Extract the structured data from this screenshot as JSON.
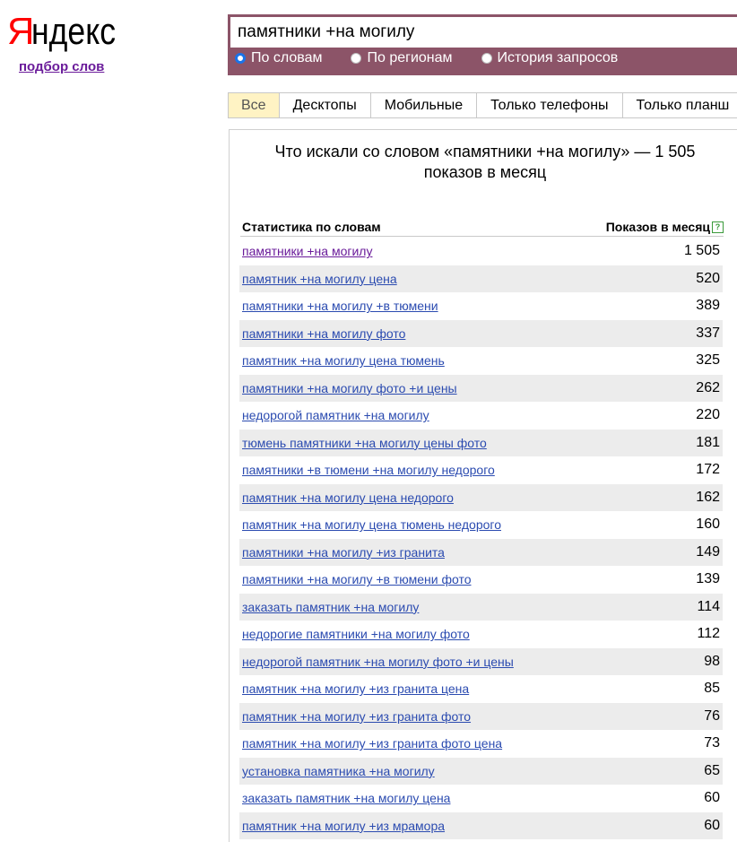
{
  "logo": {
    "text": "Яндекс"
  },
  "subtitle": "подбор слов",
  "search": {
    "value": "памятники +на могилу"
  },
  "radios": [
    {
      "label": "По словам",
      "checked": true
    },
    {
      "label": "По регионам",
      "checked": false
    },
    {
      "label": "История запросов",
      "checked": false
    }
  ],
  "tabs": [
    {
      "label": "Все",
      "active": true
    },
    {
      "label": "Десктопы",
      "active": false
    },
    {
      "label": "Мобильные",
      "active": false
    },
    {
      "label": "Только телефоны",
      "active": false
    },
    {
      "label": "Только планш",
      "active": false
    }
  ],
  "panel": {
    "heading": "Что искали со словом «памятники +на могилу» — 1 505 показов в месяц",
    "col_left": "Статистика по словам",
    "col_right": "Показов в месяц",
    "help_icon": "?"
  },
  "rows": [
    {
      "phrase": "памятники +на могилу",
      "count": "1 505"
    },
    {
      "phrase": "памятник +на могилу цена",
      "count": "520"
    },
    {
      "phrase": "памятники +на могилу +в тюмени",
      "count": "389"
    },
    {
      "phrase": "памятники +на могилу фото",
      "count": "337"
    },
    {
      "phrase": "памятник +на могилу цена тюмень",
      "count": "325"
    },
    {
      "phrase": "памятники +на могилу фото +и цены",
      "count": "262"
    },
    {
      "phrase": "недорогой памятник +на могилу",
      "count": "220"
    },
    {
      "phrase": "тюмень памятники +на могилу цены фото",
      "count": "181"
    },
    {
      "phrase": "памятники +в тюмени +на могилу недорого",
      "count": "172"
    },
    {
      "phrase": "памятник +на могилу цена недорого",
      "count": "162"
    },
    {
      "phrase": "памятник +на могилу цена тюмень недорого",
      "count": "160"
    },
    {
      "phrase": "памятники +на могилу +из гранита",
      "count": "149"
    },
    {
      "phrase": "памятники +на могилу +в тюмени фото",
      "count": "139"
    },
    {
      "phrase": "заказать памятник +на могилу",
      "count": "114"
    },
    {
      "phrase": "недорогие памятники +на могилу фото",
      "count": "112"
    },
    {
      "phrase": "недорогой памятник +на могилу фото +и цены",
      "count": "98"
    },
    {
      "phrase": "памятник +на могилу +из гранита цена",
      "count": "85"
    },
    {
      "phrase": "памятник +на могилу +из гранита фото",
      "count": "76"
    },
    {
      "phrase": "памятник +на могилу +из гранита фото цена",
      "count": "73"
    },
    {
      "phrase": "установка памятника +на могилу",
      "count": "65"
    },
    {
      "phrase": "заказать памятник +на могилу цена",
      "count": "60"
    },
    {
      "phrase": "памятник +на могилу +из мрамора",
      "count": "60"
    }
  ],
  "colors": {
    "logo_red": "#ff0000",
    "search_frame": "#8c5468",
    "link": "#2b4bb0",
    "visited": "#6a1b9a",
    "active_tab": "#fff3c4"
  }
}
